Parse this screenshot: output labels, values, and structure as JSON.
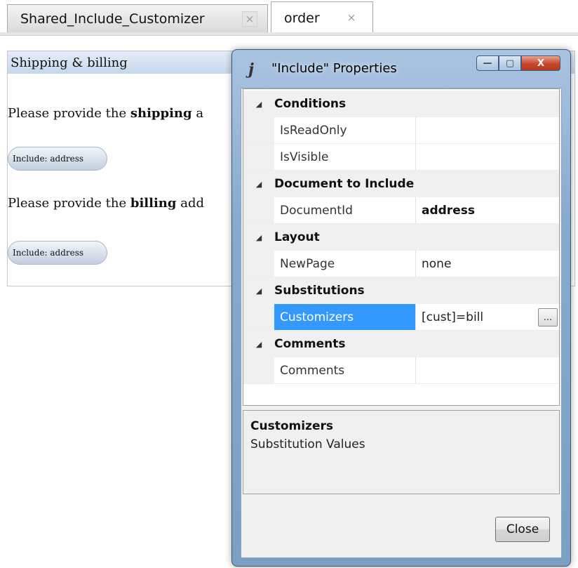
{
  "tabs": [
    {
      "label": "Shared_Include_Customizer",
      "close": "×"
    },
    {
      "label": "order",
      "close": "×"
    }
  ],
  "document": {
    "header": "Shipping & billing",
    "line1_prefix": "Please provide the ",
    "line1_bold": "shipping",
    "line1_suffix": " a",
    "pill1": "Include: address",
    "line2_prefix": "Please provide the ",
    "line2_bold": "billing",
    "line2_suffix": " add",
    "pill2": "Include: address"
  },
  "dialog": {
    "title": "\"Include\" Properties",
    "app_icon_glyph": "j",
    "min_glyph": "—",
    "max_glyph": "▢",
    "close_glyph": "X",
    "categories": {
      "conditions": "Conditions",
      "document": "Document to Include",
      "layout": "Layout",
      "substitutions": "Substitutions",
      "comments": "Comments"
    },
    "props": {
      "is_read_only": {
        "name": "IsReadOnly",
        "value": ""
      },
      "is_visible": {
        "name": "IsVisible",
        "value": ""
      },
      "document_id": {
        "name": "DocumentId",
        "value": "address"
      },
      "new_page": {
        "name": "NewPage",
        "value": "none"
      },
      "customizers": {
        "name": "Customizers",
        "value": "[cust]=bill"
      },
      "comments": {
        "name": "Comments",
        "value": ""
      }
    },
    "ellipsis": "...",
    "description": {
      "title": "Customizers",
      "text": "Substitution Values"
    },
    "close_button": "Close"
  },
  "colors": {
    "selection": "#3399ff",
    "title_close": "#c8462a"
  }
}
